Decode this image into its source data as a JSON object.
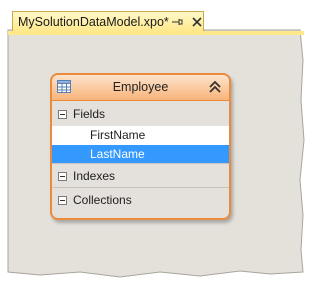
{
  "tab": {
    "title": "MySolutionDataModel.xpo*",
    "pin_icon": "pin-icon",
    "close_icon": "close-icon"
  },
  "entity": {
    "title": "Employee",
    "icon": "table-icon",
    "collapse_icon": "double-chevron-up-icon",
    "sections": {
      "fields": {
        "label": "Fields",
        "items": [
          {
            "label": "FirstName",
            "selected": false
          },
          {
            "label": "LastName",
            "selected": true
          }
        ]
      },
      "indexes": {
        "label": "Indexes"
      },
      "collections": {
        "label": "Collections"
      }
    }
  },
  "colors": {
    "tab_background": "#ffe88a",
    "canvas_background": "#e3e1da",
    "entity_border": "#e98a3c",
    "selection": "#3399ff"
  }
}
